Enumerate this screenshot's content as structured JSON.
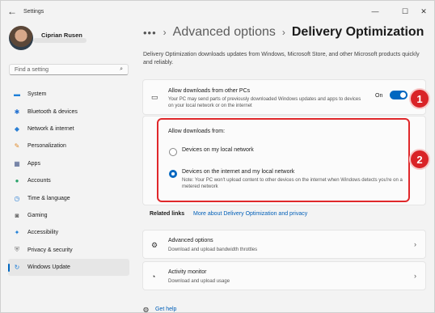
{
  "window": {
    "title": "Settings",
    "back_glyph": "←",
    "minimize_glyph": "—",
    "maximize_glyph": "☐",
    "close_glyph": "✕"
  },
  "profile": {
    "name": "Ciprian Rusen"
  },
  "search": {
    "placeholder": "Find a setting",
    "icon": "search-icon"
  },
  "sidebar": {
    "items": [
      {
        "label": "System",
        "icon": "system-icon",
        "color": "#1e7fd8",
        "glyph": "▬"
      },
      {
        "label": "Bluetooth & devices",
        "icon": "bluetooth-icon",
        "color": "#1f6fd0",
        "glyph": "✱"
      },
      {
        "label": "Network & internet",
        "icon": "network-icon",
        "color": "#2b7fd4",
        "glyph": "◆"
      },
      {
        "label": "Personalization",
        "icon": "brush-icon",
        "color": "#e08a2a",
        "glyph": "✎"
      },
      {
        "label": "Apps",
        "icon": "apps-icon",
        "color": "#4a5d8c",
        "glyph": "▦"
      },
      {
        "label": "Accounts",
        "icon": "accounts-icon",
        "color": "#2aa36b",
        "glyph": "●"
      },
      {
        "label": "Time & language",
        "icon": "time-language-icon",
        "color": "#2b7fd4",
        "glyph": "◷"
      },
      {
        "label": "Gaming",
        "icon": "gaming-icon",
        "color": "#6b6b6b",
        "glyph": "◙"
      },
      {
        "label": "Accessibility",
        "icon": "accessibility-icon",
        "color": "#1e7fd8",
        "glyph": "✦"
      },
      {
        "label": "Privacy & security",
        "icon": "shield-icon",
        "color": "#7a7a7a",
        "glyph": "⛨"
      },
      {
        "label": "Windows Update",
        "icon": "windows-update-icon",
        "color": "#1e7fd8",
        "glyph": "↻",
        "active": true
      }
    ]
  },
  "breadcrumb": {
    "ellipsis": "•••",
    "separator": "›",
    "parent": "Advanced options",
    "current": "Delivery Optimization"
  },
  "description": "Delivery Optimization downloads updates from Windows, Microsoft Store, and other Microsoft products quickly and reliably.",
  "allow_card": {
    "title": "Allow downloads from other PCs",
    "subtitle": "Your PC may send parts of previously downloaded Windows updates and apps to devices on your local network or on the internet",
    "toggle_label": "On",
    "toggle_on": true
  },
  "downloads_from": {
    "heading": "Allow downloads from:",
    "options": [
      {
        "label": "Devices on my local network",
        "selected": false
      },
      {
        "label": "Devices on the internet and my local network",
        "selected": true,
        "note": "Note: Your PC won't upload content to other devices on the internet when Windows detects you're on a metered network"
      }
    ]
  },
  "related": {
    "label": "Related links",
    "link": "More about Delivery Optimization and privacy"
  },
  "advanced_options": {
    "title": "Advanced options",
    "subtitle": "Download and upload bandwidth throttles"
  },
  "activity_monitor": {
    "title": "Activity monitor",
    "subtitle": "Download and upload usage"
  },
  "help": {
    "label": "Get help"
  },
  "annotations": {
    "badge1": "1",
    "badge2": "2",
    "accent": "#e0282b"
  },
  "colors": {
    "accent": "#0067c0",
    "link": "#005fb8"
  }
}
